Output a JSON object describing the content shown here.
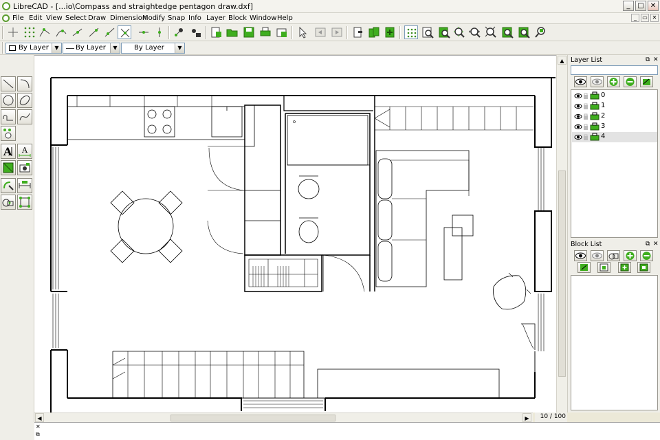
{
  "window": {
    "title": "LibreCAD - [...io\\Compass and straightedge  pentagon draw.dxf]"
  },
  "menu": [
    "File",
    "Edit",
    "View",
    "Select",
    "Draw",
    "Dimension",
    "Modify",
    "Snap",
    "Info",
    "Layer",
    "Block",
    "Window",
    "Help"
  ],
  "pen_toolbar": {
    "color": "By Layer",
    "line_type": "By Layer",
    "line_width": "By Layer"
  },
  "layer_list": {
    "title": "Layer List",
    "filter_value": "",
    "layers": [
      {
        "name": "0",
        "selected": false
      },
      {
        "name": "1",
        "selected": false
      },
      {
        "name": "2",
        "selected": false
      },
      {
        "name": "3",
        "selected": false
      },
      {
        "name": "4",
        "selected": true
      }
    ]
  },
  "block_list": {
    "title": "Block List"
  },
  "status": {
    "grid": "10 / 100"
  },
  "colors": {
    "accent_green": "#3fae1f",
    "toolbar_bg": "#efeee8",
    "canvas_bg": "#ffffff"
  },
  "icons": {
    "toolbar": [
      "snap-free-icon",
      "snap-grid-icon",
      "snap-endpoint-icon",
      "snap-on-entity-icon",
      "snap-center-icon",
      "snap-middle-icon",
      "snap-distance-icon",
      "snap-intersection-icon",
      "restrict-horizontal-icon",
      "restrict-vertical-icon",
      "relative-zero-icon",
      "lock-relative-zero-icon",
      "new-file-icon",
      "open-file-icon",
      "save-file-icon",
      "print-icon",
      "print-preview-icon",
      "select-pointer-icon",
      "undo-icon",
      "redo-icon",
      "cut-icon",
      "copy-icon",
      "paste-icon",
      "grid-toggle-icon",
      "zoom-redraw-icon",
      "zoom-in-icon",
      "zoom-out-icon",
      "zoom-auto-icon",
      "zoom-previous-icon",
      "zoom-window-icon",
      "zoom-pan-icon",
      "zoom-extra-icon"
    ],
    "left_tools": [
      "line-tool-icon",
      "arc-tool-icon",
      "circle-tool-icon",
      "ellipse-tool-icon",
      "polyline-tool-icon",
      "spline-tool-icon",
      "select-tool-icon",
      "text-tool-icon",
      "dimension-tool-icon",
      "hatch-tool-icon",
      "image-tool-icon",
      "modify-tool-icon",
      "measure-tool-icon",
      "block-tool-icon",
      "info-tool-icon"
    ],
    "layer_buttons": [
      "show-all-layers-icon",
      "hide-all-layers-icon",
      "add-layer-icon",
      "remove-layer-icon",
      "edit-layer-icon"
    ],
    "block_buttons": [
      "show-all-blocks-icon",
      "hide-all-blocks-icon",
      "create-block-icon",
      "add-block-icon",
      "remove-block-icon",
      "edit-block-icon",
      "save-block-icon",
      "insert-block-icon"
    ]
  }
}
